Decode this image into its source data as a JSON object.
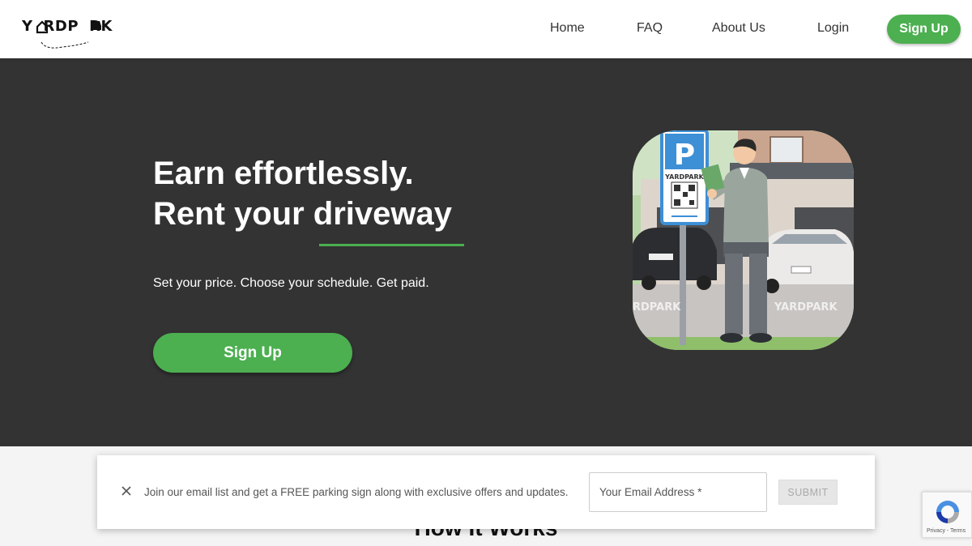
{
  "header": {
    "logo_text": "YARDPARK",
    "nav": [
      {
        "label": "Home"
      },
      {
        "label": "FAQ"
      },
      {
        "label": "About Us"
      },
      {
        "label": "Login"
      }
    ],
    "signup_label": "Sign Up",
    "accent_color": "#4caf50"
  },
  "hero": {
    "title_line1": "Earn effortlessly.",
    "title_line2": "Rent your driveway",
    "subtitle": "Set your price. Choose your schedule. Get paid.",
    "cta_label": "Sign Up",
    "background_color": "#333333",
    "image": {
      "sign_letter": "P",
      "sign_brand": "YARDPARK",
      "pavement_text_left": "RDPARK",
      "pavement_text_right": "YARDPARK"
    }
  },
  "how_it_works": {
    "title": "How It Works"
  },
  "email_popup": {
    "message": "Join our email list and get a FREE parking sign along with exclusive offers and updates.",
    "email_placeholder": "Your Email Address *",
    "submit_label": "SUBMIT",
    "close_icon": "close-icon"
  },
  "recaptcha": {
    "text": "Privacy - Terms"
  }
}
